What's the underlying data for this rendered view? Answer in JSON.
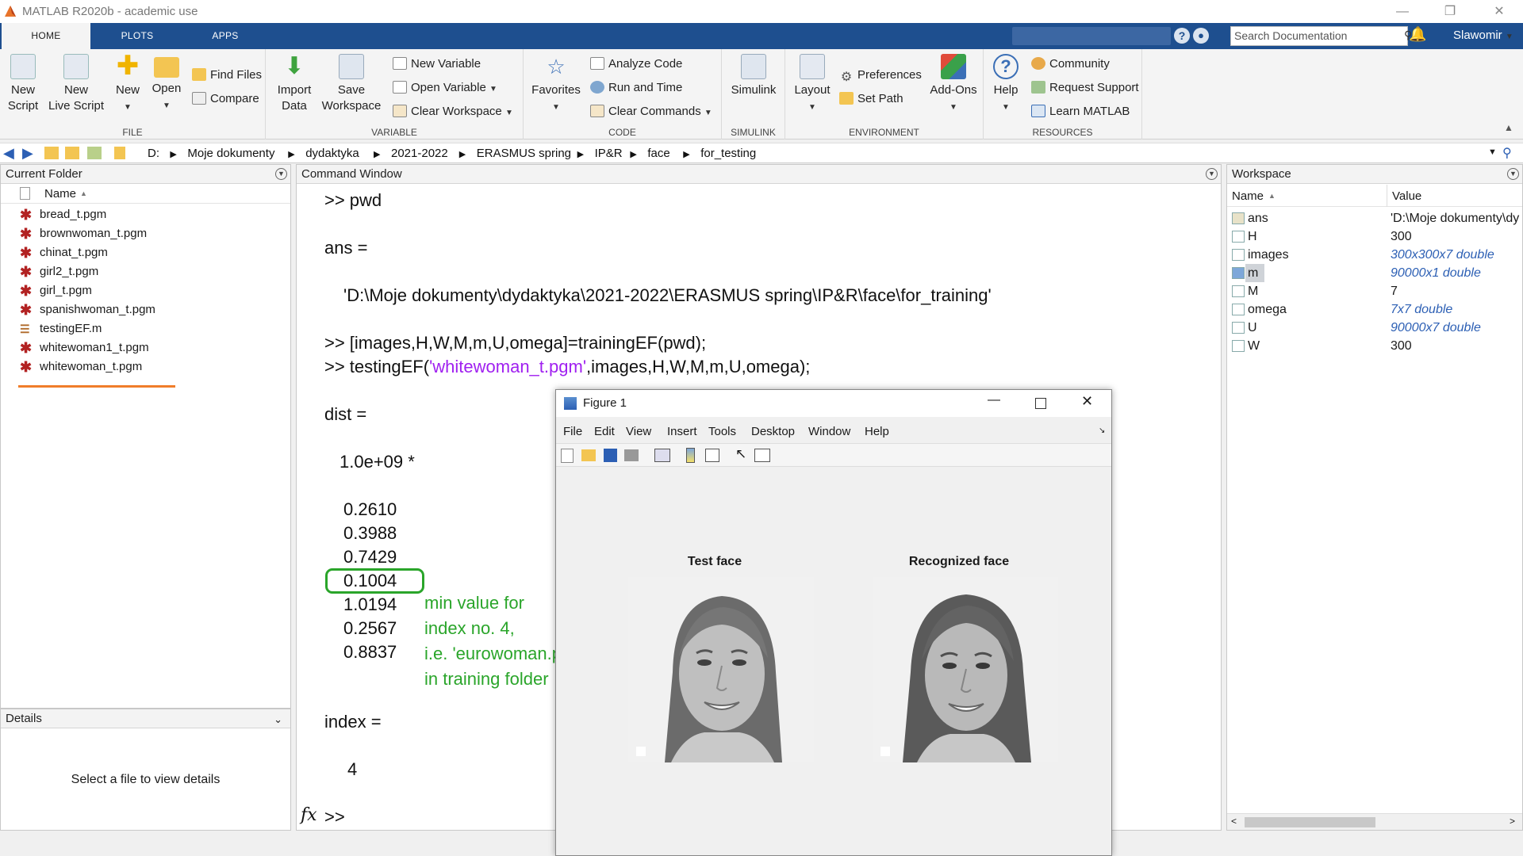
{
  "window": {
    "title": "MATLAB R2020b - academic use",
    "user": "Slawomir"
  },
  "tabs": [
    "HOME",
    "PLOTS",
    "APPS"
  ],
  "search": {
    "placeholder": "Search Documentation"
  },
  "ribbon": {
    "file": {
      "label": "FILE",
      "new_script": [
        "New",
        "Script"
      ],
      "new_live_script": [
        "New",
        "Live Script"
      ],
      "new": "New",
      "open": "Open",
      "find_files": "Find Files",
      "compare": "Compare"
    },
    "variable": {
      "label": "VARIABLE",
      "import_data": [
        "Import",
        "Data"
      ],
      "save_workspace": [
        "Save",
        "Workspace"
      ],
      "new_variable": "New Variable",
      "open_variable": "Open Variable",
      "clear_workspace": "Clear Workspace"
    },
    "code": {
      "label": "CODE",
      "favorites": "Favorites",
      "analyze_code": "Analyze Code",
      "run_and_time": "Run and Time",
      "clear_commands": "Clear Commands"
    },
    "simulink": {
      "label": "SIMULINK",
      "simulink": "Simulink"
    },
    "environment": {
      "label": "ENVIRONMENT",
      "layout": "Layout",
      "preferences": "Preferences",
      "set_path": "Set Path",
      "add_ons": "Add-Ons"
    },
    "resources": {
      "label": "RESOURCES",
      "help": "Help",
      "community": "Community",
      "request_support": "Request Support",
      "learn_matlab": "Learn MATLAB"
    }
  },
  "path": [
    "D:",
    "Moje dokumenty",
    "dydaktyka",
    "2021-2022",
    "ERASMUS spring",
    "IP&R",
    "face",
    "for_testing"
  ],
  "current_folder": {
    "title": "Current Folder",
    "column": "Name",
    "files": [
      "bread_t.pgm",
      "brownwoman_t.pgm",
      "chinat_t.pgm",
      "girl2_t.pgm",
      "girl_t.pgm",
      "spanishwoman_t.pgm",
      "testingEF.m",
      "whitewoman1_t.pgm",
      "whitewoman_t.pgm"
    ]
  },
  "details": {
    "title": "Details",
    "message": "Select a file to view details"
  },
  "command_window": {
    "title": "Command Window",
    "l1": ">> pwd",
    "l2": "ans =",
    "l3": "'D:\\Moje dokumenty\\dydaktyka\\2021-2022\\ERASMUS spring\\IP&R\\face\\for_training'",
    "l4": ">> [images,H,W,M,m,U,omega]=trainingEF(pwd);",
    "l5a": ">> testingEF(",
    "l5b": "'whitewoman_t.pgm'",
    "l5c": ",images,H,W,M,m,U,omega);",
    "l6": "dist =",
    "l7": "1.0e+09 *",
    "dist_values": [
      "0.2610",
      "0.3988",
      "0.7429",
      "0.1004",
      "1.0194",
      "0.2567",
      "0.8837"
    ],
    "annotation": [
      "min value for",
      "index no. 4,",
      "i.e. 'eurowoman.pgm'",
      "in training folder"
    ],
    "l8": "index =",
    "l9": "4",
    "prompt": ">>",
    "fx": "fx"
  },
  "workspace": {
    "title": "Workspace",
    "columns": [
      "Name",
      "Value"
    ],
    "vars": [
      {
        "name": "ans",
        "value": "'D:\\Moje dokumenty\\dy"
      },
      {
        "name": "H",
        "value": "300"
      },
      {
        "name": "images",
        "value": "300x300x7 double"
      },
      {
        "name": "m",
        "value": "90000x1 double"
      },
      {
        "name": "M",
        "value": "7"
      },
      {
        "name": "omega",
        "value": "7x7 double"
      },
      {
        "name": "U",
        "value": "90000x7 double"
      },
      {
        "name": "W",
        "value": "300"
      }
    ]
  },
  "figure": {
    "title": "Figure 1",
    "menu": [
      "File",
      "Edit",
      "View",
      "Insert",
      "Tools",
      "Desktop",
      "Window",
      "Help"
    ],
    "test_title": "Test face",
    "recognized_title": "Recognized face"
  },
  "colors": {
    "ribbon_blue": "#1e4f8f",
    "annotation_green": "#2aa52a",
    "string_purple": "#a020f0",
    "underline_orange": "#f07d2a"
  }
}
